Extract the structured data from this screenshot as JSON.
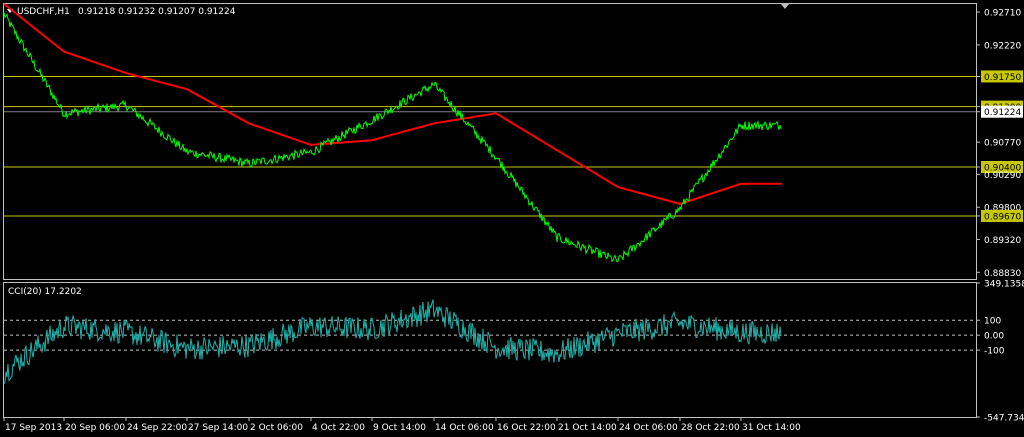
{
  "header": {
    "symbol_label": "USDCHF,H1",
    "ohlc": "0.91218 0.91232 0.91207 0.91224"
  },
  "cci_panel": {
    "label": "CCI(20) 17.2202",
    "scale_labels": [
      "349.1358",
      "100",
      "0.00",
      "-100",
      "-547.7342"
    ]
  },
  "price_axis": {
    "labels": [
      "0.92710",
      "0.92220",
      "0.91750",
      "0.91300",
      "0.91224",
      "0.90770",
      "0.90400",
      "0.90290",
      "0.89800",
      "0.89670",
      "0.89320",
      "0.88830"
    ]
  },
  "time_axis": {
    "labels": [
      "17 Sep 2013",
      "20 Sep 06:00",
      "24 Sep 22:00",
      "27 Sep 14:00",
      "2 Oct 06:00",
      "4 Oct 22:00",
      "9 Oct 14:00",
      "14 Oct 06:00",
      "16 Oct 22:00",
      "21 Oct 14:00",
      "24 Oct 06:00",
      "28 Oct 22:00",
      "31 Oct 14:00"
    ]
  },
  "colors": {
    "background": "#000000",
    "price": "#00ff00",
    "ma": "#ff0000",
    "level": "#c8c800",
    "cci": "#20b2aa",
    "grid": "#c0c0c0",
    "text": "#ffffff",
    "current_price_bg": "#ffffff",
    "current_price_fg": "#000000"
  },
  "chart_data": [
    {
      "type": "line",
      "title": "USDCHF,H1",
      "ylim": [
        0.8873,
        0.9283
      ],
      "horizontal_levels": [
        0.9175,
        0.913,
        0.904,
        0.8967
      ],
      "current_price": 0.91224,
      "series": [
        {
          "role": "price",
          "points": [
            [
              "17 Sep 2013",
              0.9268
            ],
            [
              "20 Sep 06:00",
              0.912
            ],
            [
              "24 Sep 22:00",
              0.9132
            ],
            [
              "27 Sep 14:00",
              0.9063
            ],
            [
              "2 Oct 06:00",
              0.9045
            ],
            [
              "4 Oct 22:00",
              0.9062
            ],
            [
              "9 Oct 14:00",
              0.911
            ],
            [
              "14 Oct 06:00",
              0.9163
            ],
            [
              "16 Oct 22:00",
              0.9055
            ],
            [
              "21 Oct 14:00",
              0.8935
            ],
            [
              "24 Oct 06:00",
              0.89
            ],
            [
              "28 Oct 22:00",
              0.8978
            ],
            [
              "31 Oct 14:00",
              0.9102
            ]
          ]
        },
        {
          "role": "moving-average",
          "points": [
            [
              "17 Sep 2013",
              0.9283
            ],
            [
              "20 Sep 06:00",
              0.9212
            ],
            [
              "24 Sep 22:00",
              0.918
            ],
            [
              "27 Sep 14:00",
              0.9156
            ],
            [
              "2 Oct 06:00",
              0.9105
            ],
            [
              "4 Oct 22:00",
              0.9073
            ],
            [
              "9 Oct 14:00",
              0.908
            ],
            [
              "14 Oct 06:00",
              0.9105
            ],
            [
              "16 Oct 22:00",
              0.912
            ],
            [
              "21 Oct 14:00",
              0.9065
            ],
            [
              "24 Oct 06:00",
              0.901
            ],
            [
              "28 Oct 22:00",
              0.8985
            ],
            [
              "31 Oct 14:00",
              0.9015
            ]
          ]
        }
      ]
    },
    {
      "type": "line",
      "title": "CCI(20) 17.2202",
      "ylim": [
        -547.7342,
        349.1358
      ],
      "reference_levels": [
        100,
        0,
        -100
      ],
      "series": [
        {
          "role": "cci",
          "points": [
            [
              "17 Sep 2013",
              -250
            ],
            [
              "20 Sep 06:00",
              60
            ],
            [
              "24 Sep 22:00",
              20
            ],
            [
              "27 Sep 14:00",
              -90
            ],
            [
              "2 Oct 06:00",
              -70
            ],
            [
              "4 Oct 22:00",
              60
            ],
            [
              "9 Oct 14:00",
              40
            ],
            [
              "14 Oct 06:00",
              170
            ],
            [
              "16 Oct 22:00",
              -80
            ],
            [
              "21 Oct 14:00",
              -120
            ],
            [
              "24 Oct 06:00",
              10
            ],
            [
              "28 Oct 22:00",
              80
            ],
            [
              "31 Oct 14:00",
              17.2202
            ]
          ]
        }
      ]
    }
  ]
}
